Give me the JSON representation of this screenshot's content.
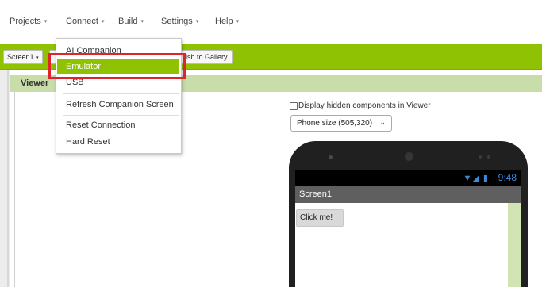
{
  "menubar": {
    "items": [
      {
        "label": "Projects"
      },
      {
        "label": "Connect"
      },
      {
        "label": "Build"
      },
      {
        "label": "Settings"
      },
      {
        "label": "Help"
      }
    ],
    "caret": "▾"
  },
  "toolbar": {
    "screen_select": "Screen1",
    "screen_caret": "▾",
    "publish_label": "lish to Gallery"
  },
  "viewer": {
    "title": "Viewer",
    "hidden_components_label": "Display hidden components in Viewer",
    "size_select_value": "Phone size (505,320)",
    "chevron": "⌄"
  },
  "connect_menu": {
    "items": [
      {
        "label": "AI Companion"
      },
      {
        "label": "Emulator"
      },
      {
        "label": "USB"
      },
      {
        "label": "Refresh Companion Screen"
      },
      {
        "label": "Reset Connection"
      },
      {
        "label": "Hard Reset"
      }
    ],
    "highlighted": "Emulator"
  },
  "phone": {
    "time": "9:48",
    "status_icons": "▼◢ ▮",
    "screen_title": "Screen1",
    "button_label": "Click me!"
  },
  "colors": {
    "accent_green": "#8fc202",
    "viewer_header": "#c9ddaa",
    "highlight_box": "#e0242c",
    "status_blue": "#3a8ad8"
  }
}
